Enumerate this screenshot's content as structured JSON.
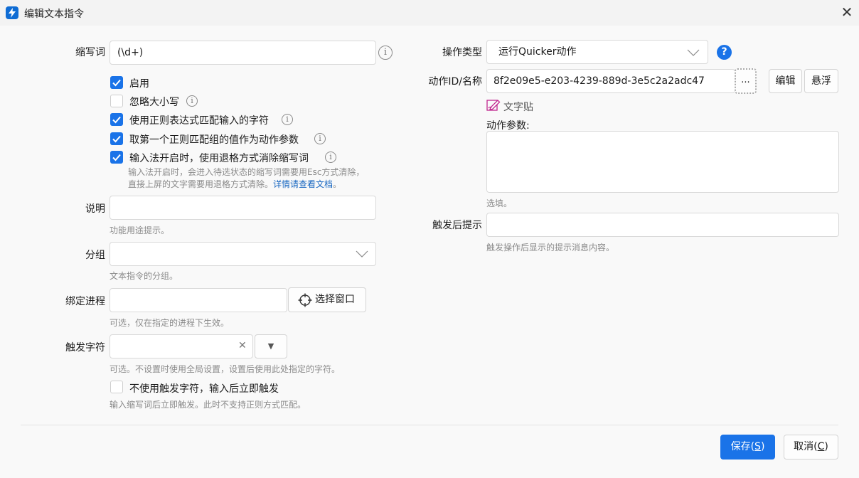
{
  "window": {
    "title": "编辑文本指令",
    "accent": "#1a73e8"
  },
  "left": {
    "abbr_label": "缩写词",
    "abbr_value": "(\\d+)",
    "checkboxes": [
      {
        "label": "启用",
        "checked": true
      },
      {
        "label": "忽略大小写",
        "checked": false
      },
      {
        "label": "使用正则表达式匹配输入的字符",
        "checked": true
      },
      {
        "label": "取第一个正则匹配组的值作为动作参数",
        "checked": true
      },
      {
        "label": "输入法开启时，使用退格方式消除缩写词",
        "checked": true
      }
    ],
    "ime_hint_line1": "输入法开启时，会进入待选状态的缩写词需要用Esc方式清除，",
    "ime_hint_line2": "直接上屏的文字需要用退格方式清除。",
    "ime_hint_link": "详情请查看文档",
    "ime_hint_end": "。",
    "desc_label": "说明",
    "desc_value": "",
    "desc_hint": "功能用途提示。",
    "group_label": "分组",
    "group_value": "",
    "group_hint": "文本指令的分组。",
    "process_label": "绑定进程",
    "process_value": "",
    "select_window_label": "选择窗口",
    "process_hint": "可选，仅在指定的进程下生效。",
    "trigger_label": "触发字符",
    "trigger_value": "",
    "trigger_hint": "可选。不设置时使用全局设置，设置后使用此处指定的字符。",
    "no_trigger_label": "不使用触发字符，输入后立即触发",
    "no_trigger_checked": false,
    "no_trigger_hint": "输入缩写词后立即触发。此时不支持正则方式匹配。"
  },
  "right": {
    "op_type_label": "操作类型",
    "op_type_value": "运行Quicker动作",
    "action_id_label": "动作ID/名称",
    "action_id_value": "8f2e09e5-e203-4239-889d-3e5c2a2adc47",
    "browse_label": "...",
    "edit_label": "编辑",
    "float_label": "悬浮",
    "action_name": "文字贴",
    "params_label": "动作参数:",
    "params_value": "",
    "params_hint": "选填。",
    "after_label": "触发后提示",
    "after_value": "",
    "after_hint": "触发操作后显示的提示消息内容。"
  },
  "footer": {
    "save_text": "保存(",
    "save_key": "S",
    "save_end": ")",
    "cancel_text": "取消(",
    "cancel_key": "C",
    "cancel_end": ")"
  }
}
